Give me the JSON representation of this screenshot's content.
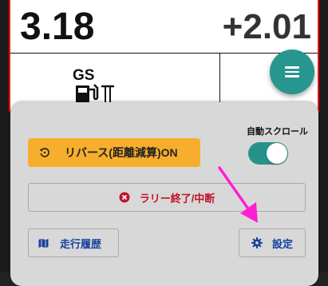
{
  "odometer": {
    "distance": "3.18",
    "delta": "+2.01"
  },
  "fuel": {
    "label": "GS",
    "icon": "gas-station-icon"
  },
  "menu": {
    "icon": "hamburger-menu-icon"
  },
  "panel": {
    "auto_scroll_label": "自動スクロール",
    "auto_scroll_on": true,
    "reverse_label": "リバース(距離減算)ON",
    "end_rally_label": "ラリー終了/中断",
    "history_label": "走行履歴",
    "settings_label": "設定"
  },
  "colors": {
    "accent": "#26968f",
    "reverse_bg": "#f7ae2c",
    "danger": "#c0142b",
    "link": "#17409c",
    "annotation_arrow": "#ff1fd2"
  }
}
